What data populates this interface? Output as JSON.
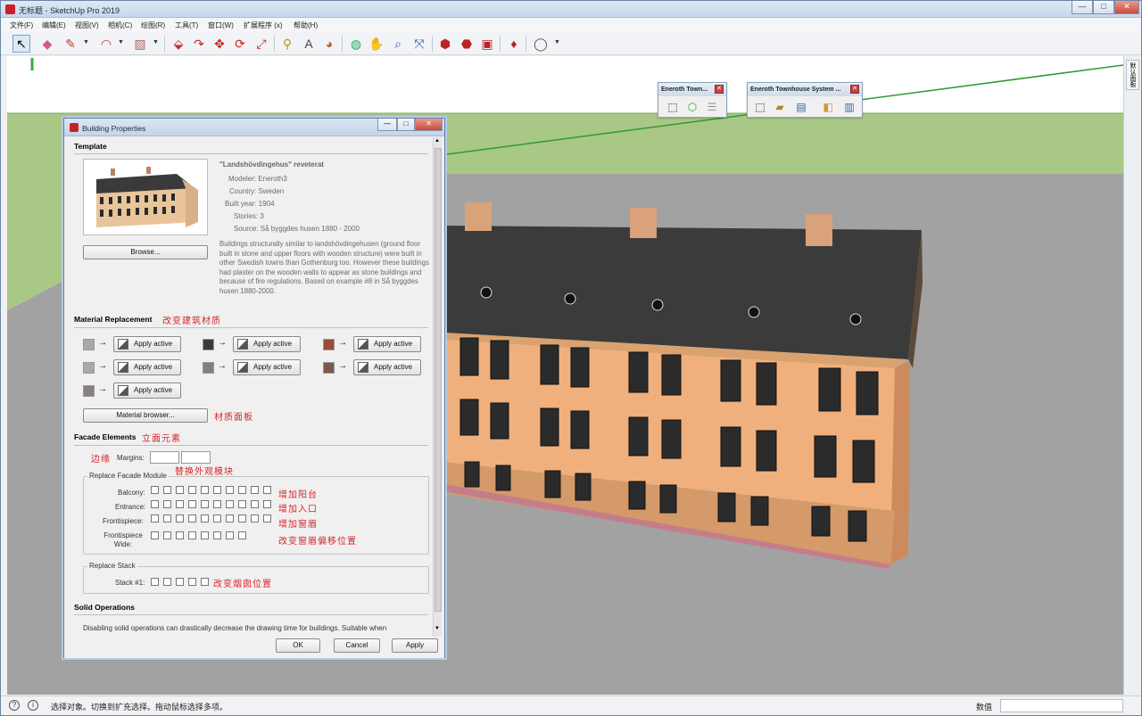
{
  "window": {
    "title": "无标题 - SketchUp Pro 2019",
    "controls": [
      "—",
      "□",
      "✕"
    ]
  },
  "menu": [
    "文件(F)",
    "编辑(E)",
    "视图(V)",
    "相机(C)",
    "绘图(R)",
    "工具(T)",
    "窗口(W)",
    "扩展程序 (x)",
    "帮助(H)"
  ],
  "toolbar": {
    "tools": [
      "select-icon",
      "eraser-icon",
      "pencil-icon",
      "arc-icon",
      "rectangle-icon",
      "push-pull-icon",
      "follow-me-icon",
      "move-icon",
      "rotate-icon",
      "scale-icon",
      "tape-measure-icon",
      "text-icon",
      "paint-bucket-icon",
      "orbit-icon",
      "pan-icon",
      "zoom-icon",
      "zoom-extents-icon",
      "warehouse-icon",
      "extension-warehouse-icon",
      "layout-icon",
      "ruby-icon",
      "account-icon"
    ]
  },
  "eneroth_small": {
    "title": "Eneroth Town..."
  },
  "eneroth_large": {
    "title": "Eneroth Townhouse System ..."
  },
  "right_panel": {
    "tab": "默认面板"
  },
  "dialog": {
    "title": "Building Properties",
    "template": {
      "heading": "Template",
      "name": "\"Landshövdingehus\" reveterat",
      "modeler": "Modeler: Eneroth3",
      "country": "Country: Sweden",
      "built_year": "Built year: 1904",
      "stories": "Stories: 3",
      "source": "Source: Så byggdes husen 1880 - 2000",
      "description": "Buildings structurally similar to landshövdingehusen (ground floor built in stone and upper floors with wooden structure) were built in other Swedish towns than Gothenburg too. However these buildings had plaster on the wooden walls to appear as stone buildings and because of fire regulations. Based on example #8 in Så byggdes husen 1880-2000.",
      "browse": "Browse..."
    },
    "material": {
      "heading": "Material Replacement",
      "note": "改变建筑材质",
      "apply_label": "Apply active",
      "swatches": [
        "#a8a8a8",
        "#3a3a3a",
        "#9c4a3c",
        "#a8a8a8",
        "#8a7c7a",
        "#7a5a4c",
        "#8a7e7e"
      ],
      "browser": "Material browser...",
      "browser_note": "材质面板"
    },
    "facade": {
      "heading": "Facade Elements",
      "note": "立面元素",
      "margins_note": "边缘",
      "margins_label": "Margins:",
      "module_group": "Replace Facade Module",
      "module_note": "替换外观模块",
      "rows": [
        {
          "label": "Balcony:",
          "count": 10,
          "note": "增加阳台"
        },
        {
          "label": "Entrance:",
          "count": 10,
          "note": "增加入口"
        },
        {
          "label": "Frontispiece:",
          "count": 10,
          "note": "增加窗眉"
        },
        {
          "label": "Frontispiece Wide:",
          "count": 8,
          "note": "改变窗眉偏移位置"
        }
      ],
      "stack_group": "Replace Stack",
      "stack_label": "Stack #1:",
      "stack_count": 5,
      "stack_note": "改变烟囱位置"
    },
    "solid": {
      "heading": "Solid Operations",
      "text": "Disabling solid operations can drastically decrease the drawing time for buildings. Suitable when"
    },
    "buttons": {
      "ok": "OK",
      "cancel": "Cancel",
      "apply": "Apply"
    }
  },
  "status": {
    "text": "选择对象。切换到扩充选择。拖动鼠标选择多项。",
    "measure_label": "数值"
  }
}
